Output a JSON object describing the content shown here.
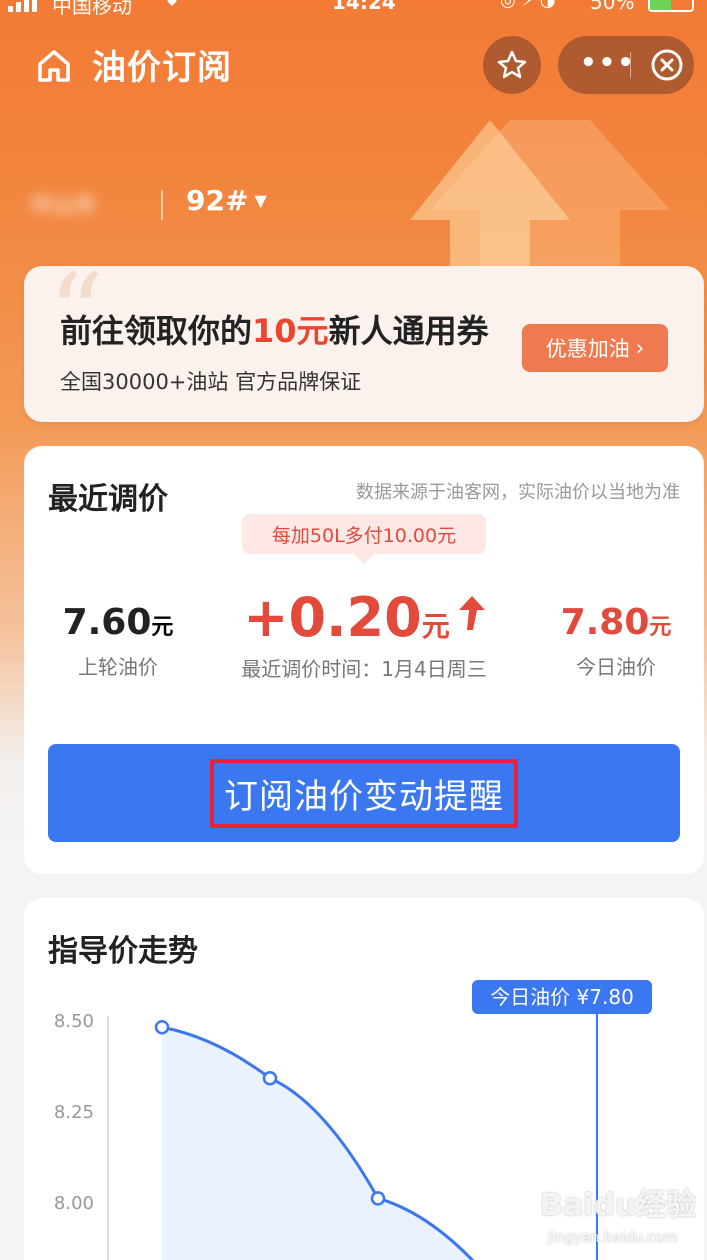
{
  "status_bar": {
    "carrier": "中国移动",
    "time": "14:24",
    "battery": "50%"
  },
  "nav": {
    "title": "油价订阅",
    "more_label": "•••"
  },
  "selector": {
    "location": "中山市",
    "fuel_grade": "92#"
  },
  "banner": {
    "headline_prefix": "前往领取你的",
    "headline_highlight": "10元",
    "headline_suffix": "新人通用券",
    "subtitle": "全国30000+油站 官方品牌保证",
    "cta_label": "优惠加油",
    "cta_arrow": "›"
  },
  "recent": {
    "title": "最近调价",
    "source_note": "数据来源于油客网，实际油价以当地为准",
    "tip": "每加50L多付10.00元",
    "previous": {
      "value": "7.60",
      "unit": "元",
      "label": "上轮油价"
    },
    "change": {
      "value": "+0.20",
      "unit": "元",
      "label": "最近调价时间：1月4日周三"
    },
    "today": {
      "value": "7.80",
      "unit": "元",
      "label": "今日油价"
    },
    "subscribe_label": "订阅油价变动提醒"
  },
  "trend": {
    "title": "指导价走势",
    "today_tag": "今日油价 ¥7.80"
  },
  "chart_data": {
    "type": "line",
    "title": "指导价走势",
    "xlabel": "",
    "ylabel": "",
    "y_ticks": [
      "8.50",
      "8.25",
      "8.00"
    ],
    "ylim": [
      7.75,
      8.5
    ],
    "x": [
      1,
      2,
      3,
      4
    ],
    "series": [
      {
        "values": [
          8.48,
          8.34,
          8.01,
          7.8
        ]
      }
    ],
    "annotation": "今日油价 ¥7.80",
    "colors": {
      "line": "#3a77f0",
      "fill": "#e6efff"
    }
  },
  "watermark": {
    "brand": "Baidu经验",
    "url": "jingyan.baidu.com"
  }
}
